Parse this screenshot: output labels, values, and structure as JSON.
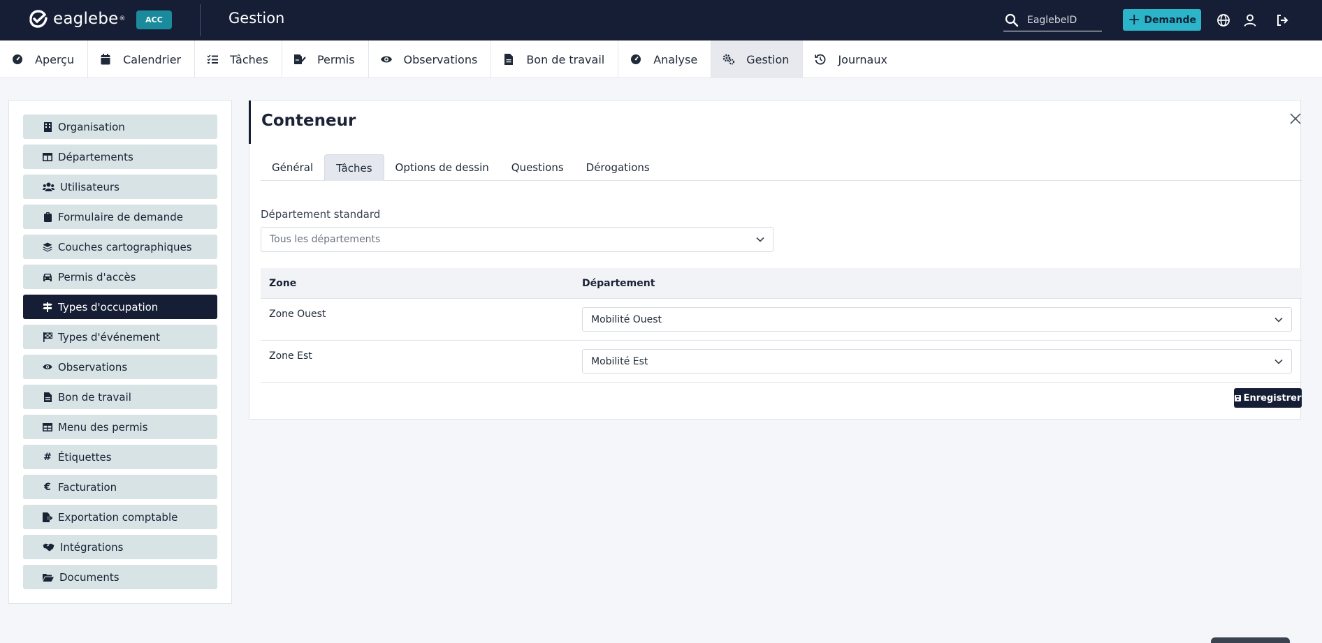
{
  "header": {
    "logo_text": "eaglebe",
    "logo_mark": "®",
    "env_badge": "ACC",
    "app_title": "Gestion",
    "search_placeholder": "EaglebeID",
    "demande_label": "Demande",
    "colors": {
      "bar": "#161e35",
      "accent": "#2cb4c8",
      "badge": "#1a8a9c"
    }
  },
  "nav": {
    "items": [
      {
        "label": "Aperçu",
        "icon": "gauge-icon"
      },
      {
        "label": "Calendrier",
        "icon": "calendar-icon"
      },
      {
        "label": "Tâches",
        "icon": "task-list-icon"
      },
      {
        "label": "Permis",
        "icon": "permit-signature-icon"
      },
      {
        "label": "Observations",
        "icon": "eye-icon"
      },
      {
        "label": "Bon de travail",
        "icon": "document-icon"
      },
      {
        "label": "Analyse",
        "icon": "gauge-icon"
      },
      {
        "label": "Gestion",
        "icon": "gears-icon",
        "active": true
      },
      {
        "label": "Journaux",
        "icon": "history-icon"
      }
    ]
  },
  "sidebar": {
    "items": [
      {
        "label": "Organisation",
        "icon": "building-icon"
      },
      {
        "label": "Départements",
        "icon": "table-columns-icon"
      },
      {
        "label": "Utilisateurs",
        "icon": "users-icon"
      },
      {
        "label": "Formulaire de demande",
        "icon": "clipboard-icon"
      },
      {
        "label": "Couches cartographiques",
        "icon": "layers-icon"
      },
      {
        "label": "Permis d'accès",
        "icon": "car-icon"
      },
      {
        "label": "Types d'occupation",
        "icon": "signs-post-icon",
        "active": true
      },
      {
        "label": "Types d'événement",
        "icon": "flag-checkered-icon"
      },
      {
        "label": "Observations",
        "icon": "eye-icon"
      },
      {
        "label": "Bon de travail",
        "icon": "file-icon"
      },
      {
        "label": "Menu des permis",
        "icon": "table-icon"
      },
      {
        "label": "Étiquettes",
        "icon": "hashtag-icon",
        "glyph": "#"
      },
      {
        "label": "Facturation",
        "icon": "euro-icon",
        "glyph": "€"
      },
      {
        "label": "Exportation comptable",
        "icon": "file-export-icon"
      },
      {
        "label": "Intégrations",
        "icon": "handshake-icon"
      },
      {
        "label": "Documents",
        "icon": "folder-open-icon"
      }
    ]
  },
  "panel": {
    "title": "Conteneur",
    "tabs": [
      {
        "label": "Général"
      },
      {
        "label": "Tâches",
        "active": true
      },
      {
        "label": "Options de dessin"
      },
      {
        "label": "Questions"
      },
      {
        "label": "Dérogations"
      }
    ],
    "standard_department": {
      "label": "Département standard",
      "value": "Tous les départements"
    },
    "table": {
      "headers": [
        "Zone",
        "Département"
      ],
      "rows": [
        {
          "zone": "Zone Ouest",
          "department": "Mobilité Ouest"
        },
        {
          "zone": "Zone Est",
          "department": "Mobilité Est"
        }
      ]
    },
    "save_label": "Enregistrer"
  }
}
